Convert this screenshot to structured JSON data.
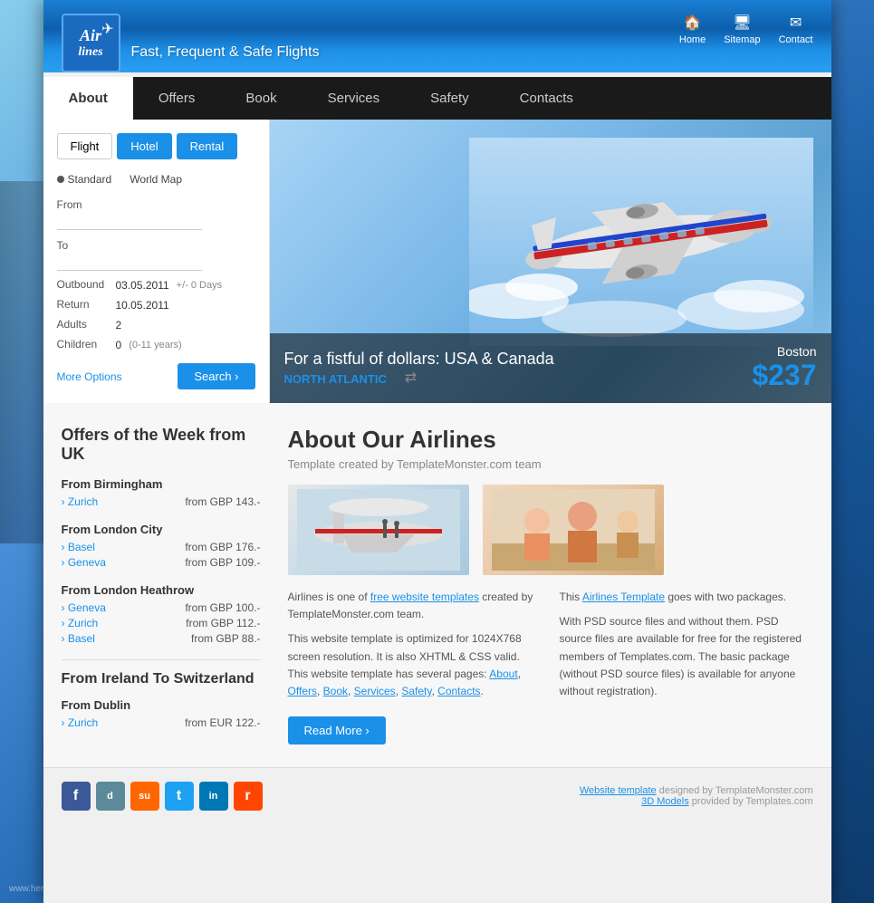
{
  "header": {
    "logo_line1": "Air",
    "logo_line2": "lines",
    "tagline": "Fast, Frequent & Safe Flights",
    "nav_icons": [
      {
        "label": "Home",
        "icon": "🏠"
      },
      {
        "label": "Sitemap",
        "icon": "🖥"
      },
      {
        "label": "Contact",
        "icon": "✉"
      }
    ]
  },
  "nav": {
    "items": [
      {
        "label": "About",
        "active": true
      },
      {
        "label": "Offers",
        "active": false
      },
      {
        "label": "Book",
        "active": false
      },
      {
        "label": "Services",
        "active": false
      },
      {
        "label": "Safety",
        "active": false
      },
      {
        "label": "Contacts",
        "active": false
      }
    ]
  },
  "search": {
    "tabs": [
      "Flight",
      "Hotel",
      "Rental"
    ],
    "active_tab": "Hotel",
    "radio_options": [
      "Standard",
      "World Map"
    ],
    "from_label": "From",
    "to_label": "To",
    "outbound_label": "Outbound",
    "outbound_value": "03.05.2011",
    "outbound_suffix": "+/- 0 Days",
    "return_label": "Return",
    "return_value": "10.05.2011",
    "adults_label": "Adults",
    "adults_value": "2",
    "children_label": "Children",
    "children_value": "0",
    "children_note": "(0-11 years)",
    "more_options_label": "More Options",
    "search_button_label": "Search ›"
  },
  "banner": {
    "title": "For a fistful of dollars: USA & Canada",
    "subtitle": "NORTH ATLANTIC",
    "city": "Boston",
    "price": "$237"
  },
  "offers": {
    "section_title": "Offers of the Week from UK",
    "groups": [
      {
        "from": "From Birmingham",
        "routes": [
          {
            "dest": "Zurich",
            "price": "from GBP 143.-"
          }
        ]
      },
      {
        "from": "From London City",
        "routes": [
          {
            "dest": "Basel",
            "price": "from GBP 176.-"
          },
          {
            "dest": "Geneva",
            "price": "from GBP 109.-"
          }
        ]
      },
      {
        "from": "From London Heathrow",
        "routes": [
          {
            "dest": "Geneva",
            "price": "from GBP 100.-"
          },
          {
            "dest": "Zurich",
            "price": "from GBP 112.-"
          },
          {
            "dest": "Basel",
            "price": "from GBP 88.-"
          }
        ]
      }
    ],
    "ireland_title": "From Ireland To Switzerland",
    "ireland_groups": [
      {
        "from": "From Dublin",
        "routes": [
          {
            "dest": "Zurich",
            "price": "from EUR 122.-"
          }
        ]
      }
    ]
  },
  "about": {
    "title": "About Our Airlines",
    "subtitle": "Template created by TemplateMonster.com team",
    "col1_text1": "Airlines is one of ",
    "col1_link1": "free website templates",
    "col1_text2": " created by TemplateMonster.com team.",
    "col1_text3": "This website template is optimized for 1024X768 screen resolution. It is also XHTML & CSS valid. This website template has several pages: ",
    "col1_links": [
      "About",
      "Offers",
      "Book",
      "Services",
      "Safety",
      "Contacts"
    ],
    "col2_text1": "This ",
    "col2_link1": "Airlines Template",
    "col2_text2": " goes with two packages.",
    "col2_text3": "With PSD source files and without them. PSD source files are available for free for the registered members of Templates.com. The basic package (without PSD source files) is available for anyone without registration).",
    "read_more_label": "Read More ›"
  },
  "footer": {
    "social": [
      {
        "name": "facebook",
        "letter": "f",
        "class": "si-fb"
      },
      {
        "name": "delicious",
        "letter": "d",
        "class": "si-del"
      },
      {
        "name": "stumbleupon",
        "letter": "su",
        "class": "si-su"
      },
      {
        "name": "twitter",
        "letter": "t",
        "class": "si-tw"
      },
      {
        "name": "linkedin",
        "letter": "in",
        "class": "si-li"
      },
      {
        "name": "reddit",
        "letter": "r",
        "class": "si-rd"
      }
    ],
    "credit_text": "Website template designed by TemplateMonster.com",
    "credit_link": "Website template",
    "credit_text2": "3D Models provided by Templates.com",
    "credit_link2": "3D Models"
  },
  "watermark": "www.herit..."
}
